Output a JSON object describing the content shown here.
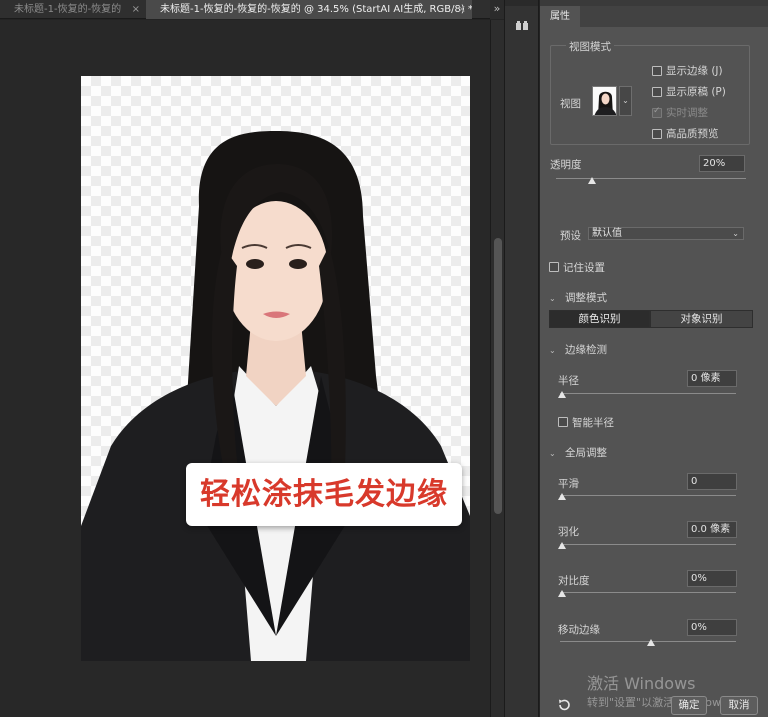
{
  "tabs": [
    {
      "label": "未标题-1-恢复的-恢复的",
      "active": false
    },
    {
      "label": "未标题-1-恢复的-恢复的-恢复的 @ 34.5% (StartAI AI生成, RGB/8) *",
      "active": true
    }
  ],
  "tab_close_glyph": "×",
  "tabbar_expand_glyph": "»",
  "canvas": {
    "caption": "轻松涂抹毛发边缘",
    "caption_color": "#d8392b"
  },
  "panel": {
    "tab_label": "属性",
    "view_mode": {
      "title": "视图模式",
      "view_label": "视图",
      "options": [
        {
          "label": "显示边缘 (J)",
          "checked": false,
          "enabled": true
        },
        {
          "label": "显示原稿 (P)",
          "checked": false,
          "enabled": true
        },
        {
          "label": "实时调整",
          "checked": true,
          "enabled": false
        },
        {
          "label": "高品质预览",
          "checked": false,
          "enabled": true
        }
      ]
    },
    "opacity": {
      "label": "透明度",
      "value": "20%",
      "slider": 0.2
    },
    "preset": {
      "label": "预设",
      "value": "默认值"
    },
    "remember": {
      "label": "记住设置",
      "checked": false
    },
    "adjust_mode": {
      "title": "调整模式",
      "options": [
        "颜色识别",
        "对象识别"
      ],
      "selected": "颜色识别"
    },
    "edge_detection": {
      "title": "边缘检测",
      "radius": {
        "label": "半径",
        "value": "0 像素",
        "slider": 0
      },
      "smart_radius": {
        "label": "智能半径",
        "checked": false
      }
    },
    "global": {
      "title": "全局调整",
      "smooth": {
        "label": "平滑",
        "value": "0",
        "slider": 0
      },
      "feather": {
        "label": "羽化",
        "value": "0.0 像素",
        "slider": 0
      },
      "contrast": {
        "label": "对比度",
        "value": "0%",
        "slider": 0
      },
      "shift_edge": {
        "label": "移动边缘",
        "value": "0%",
        "slider": 0.5
      }
    },
    "watermark": {
      "line1": "激活 Windows",
      "line2": "转到\"设置\"以激活 Windows。"
    },
    "ok_label": "确定",
    "cancel_label": "取消"
  },
  "colors": {
    "panel_bg": "#535353",
    "canvas_bg": "#282828",
    "field_bg": "#3f3f3f"
  }
}
